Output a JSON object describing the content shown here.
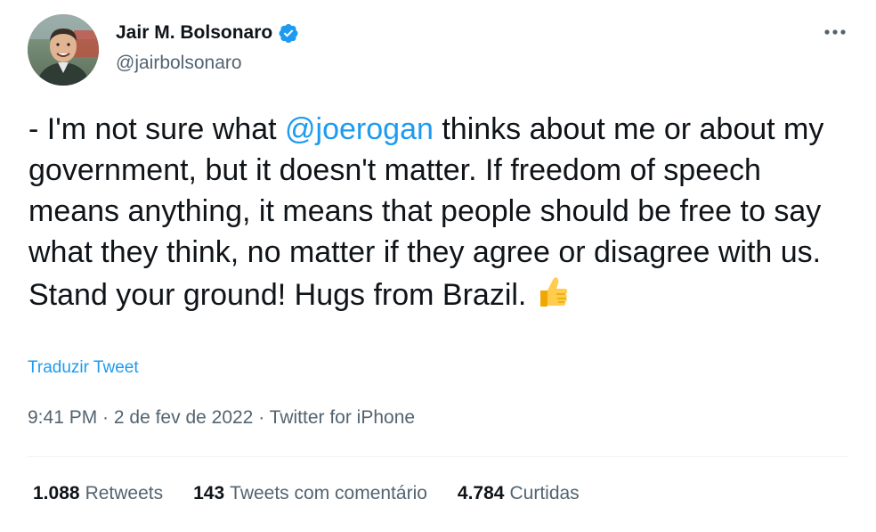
{
  "user": {
    "display_name": "Jair M. Bolsonaro",
    "handle": "@jairbolsonaro",
    "verified": true,
    "verified_color": "#1d9bf0"
  },
  "tweet": {
    "text_before_mention": "- I'm not sure what ",
    "mention": "@joerogan",
    "text_after_mention": " thinks about me or about my government, but it doesn't matter. If freedom of speech means anything, it means that people should be free to say what they think, no matter if they agree or disagree with us. Stand your ground! Hugs from Brazil.",
    "emoji": "thumbs-up"
  },
  "translate_label": "Traduzir Tweet",
  "meta": {
    "time": "9:41 PM",
    "separator": " · ",
    "date": "2 de fev de 2022",
    "source": "Twitter for iPhone"
  },
  "stats": {
    "retweets_count": "1.088",
    "retweets_label": "Retweets",
    "quotes_count": "143",
    "quotes_label": "Tweets com comentário",
    "likes_count": "4.784",
    "likes_label": "Curtidas"
  },
  "colors": {
    "link": "#1d9bf0",
    "secondary_text": "#536471",
    "primary_text": "#0f1419"
  },
  "icons": {
    "verified": "verified-badge-icon",
    "more": "more-horizontal-icon"
  }
}
